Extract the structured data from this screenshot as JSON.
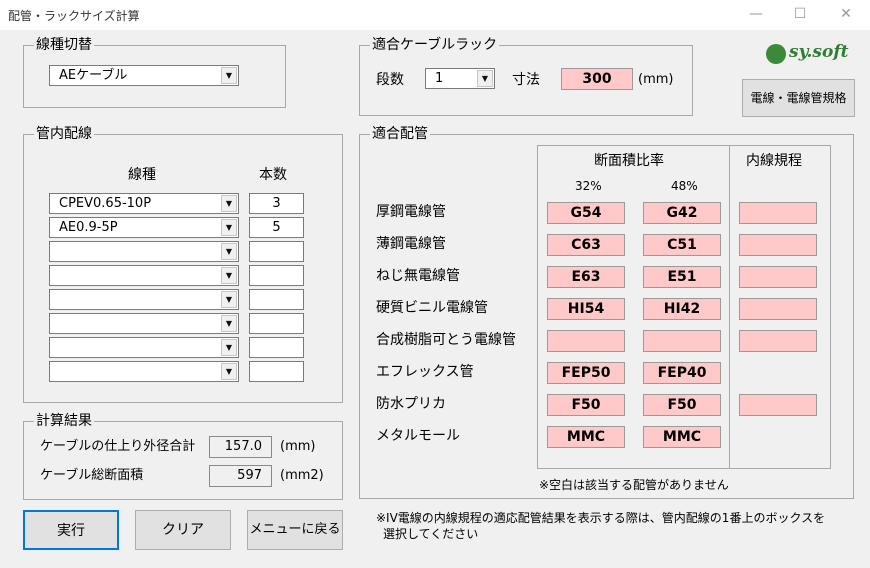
{
  "window": {
    "title": "配管・ラックサイズ計算",
    "minimize": "—",
    "maximize": "☐",
    "close": "✕"
  },
  "logo": {
    "text": "sy.soft"
  },
  "wire_type_switch": {
    "legend": "線種切替",
    "value": "AEケーブル"
  },
  "rack": {
    "legend": "適合ケーブルラック",
    "tiers_label": "段数",
    "tiers_value": "1",
    "size_label": "寸法",
    "size_value": "300",
    "size_unit": "(mm)"
  },
  "spec_button": "電線・電線管規格",
  "conduit_wiring": {
    "legend": "管内配線",
    "col_type": "線種",
    "col_count": "本数",
    "rows": [
      {
        "type": "CPEV0.65-10P",
        "count": "3"
      },
      {
        "type": "AE0.9-5P",
        "count": "5"
      },
      {
        "type": "",
        "count": ""
      },
      {
        "type": "",
        "count": ""
      },
      {
        "type": "",
        "count": ""
      },
      {
        "type": "",
        "count": ""
      },
      {
        "type": "",
        "count": ""
      },
      {
        "type": "",
        "count": ""
      }
    ]
  },
  "results": {
    "legend": "計算結果",
    "outer_label": "ケーブルの仕上り外径合計",
    "outer_value": "157.0",
    "outer_unit": "(mm)",
    "area_label": "ケーブル総断面積",
    "area_value": "597",
    "area_unit": "(mm2)"
  },
  "buttons": {
    "run": "実行",
    "clear": "クリア",
    "menu": "メニューに戻る"
  },
  "pipes": {
    "legend": "適合配管",
    "header_ratio": "断面積比率",
    "header_rule": "内線規程",
    "pct32": "32%",
    "pct48": "48%",
    "rows": [
      {
        "name": "厚鋼電線管",
        "v32": "G54",
        "v48": "G42",
        "rule": "",
        "has_rule": true
      },
      {
        "name": "薄鋼電線管",
        "v32": "C63",
        "v48": "C51",
        "rule": "",
        "has_rule": true
      },
      {
        "name": "ねじ無電線管",
        "v32": "E63",
        "v48": "E51",
        "rule": "",
        "has_rule": true
      },
      {
        "name": "硬質ビニル電線管",
        "v32": "HI54",
        "v48": "HI42",
        "rule": "",
        "has_rule": true
      },
      {
        "name": "合成樹脂可とう電線管",
        "v32": "",
        "v48": "",
        "rule": "",
        "has_rule": true
      },
      {
        "name": "エフレックス管",
        "v32": "FEP50",
        "v48": "FEP40",
        "rule": "",
        "has_rule": false
      },
      {
        "name": "防水プリカ",
        "v32": "F50",
        "v48": "F50",
        "rule": "",
        "has_rule": true
      },
      {
        "name": "メタルモール",
        "v32": "MMC",
        "v48": "MMC",
        "rule": "",
        "has_rule": false
      }
    ],
    "note": "※空白は該当する配管がありません"
  },
  "bottom_note": {
    "line1": "※IV電線の内線規程の適応配管結果を表示する際は、管内配線の1番上のボックスを",
    "line2": "選択してください"
  }
}
